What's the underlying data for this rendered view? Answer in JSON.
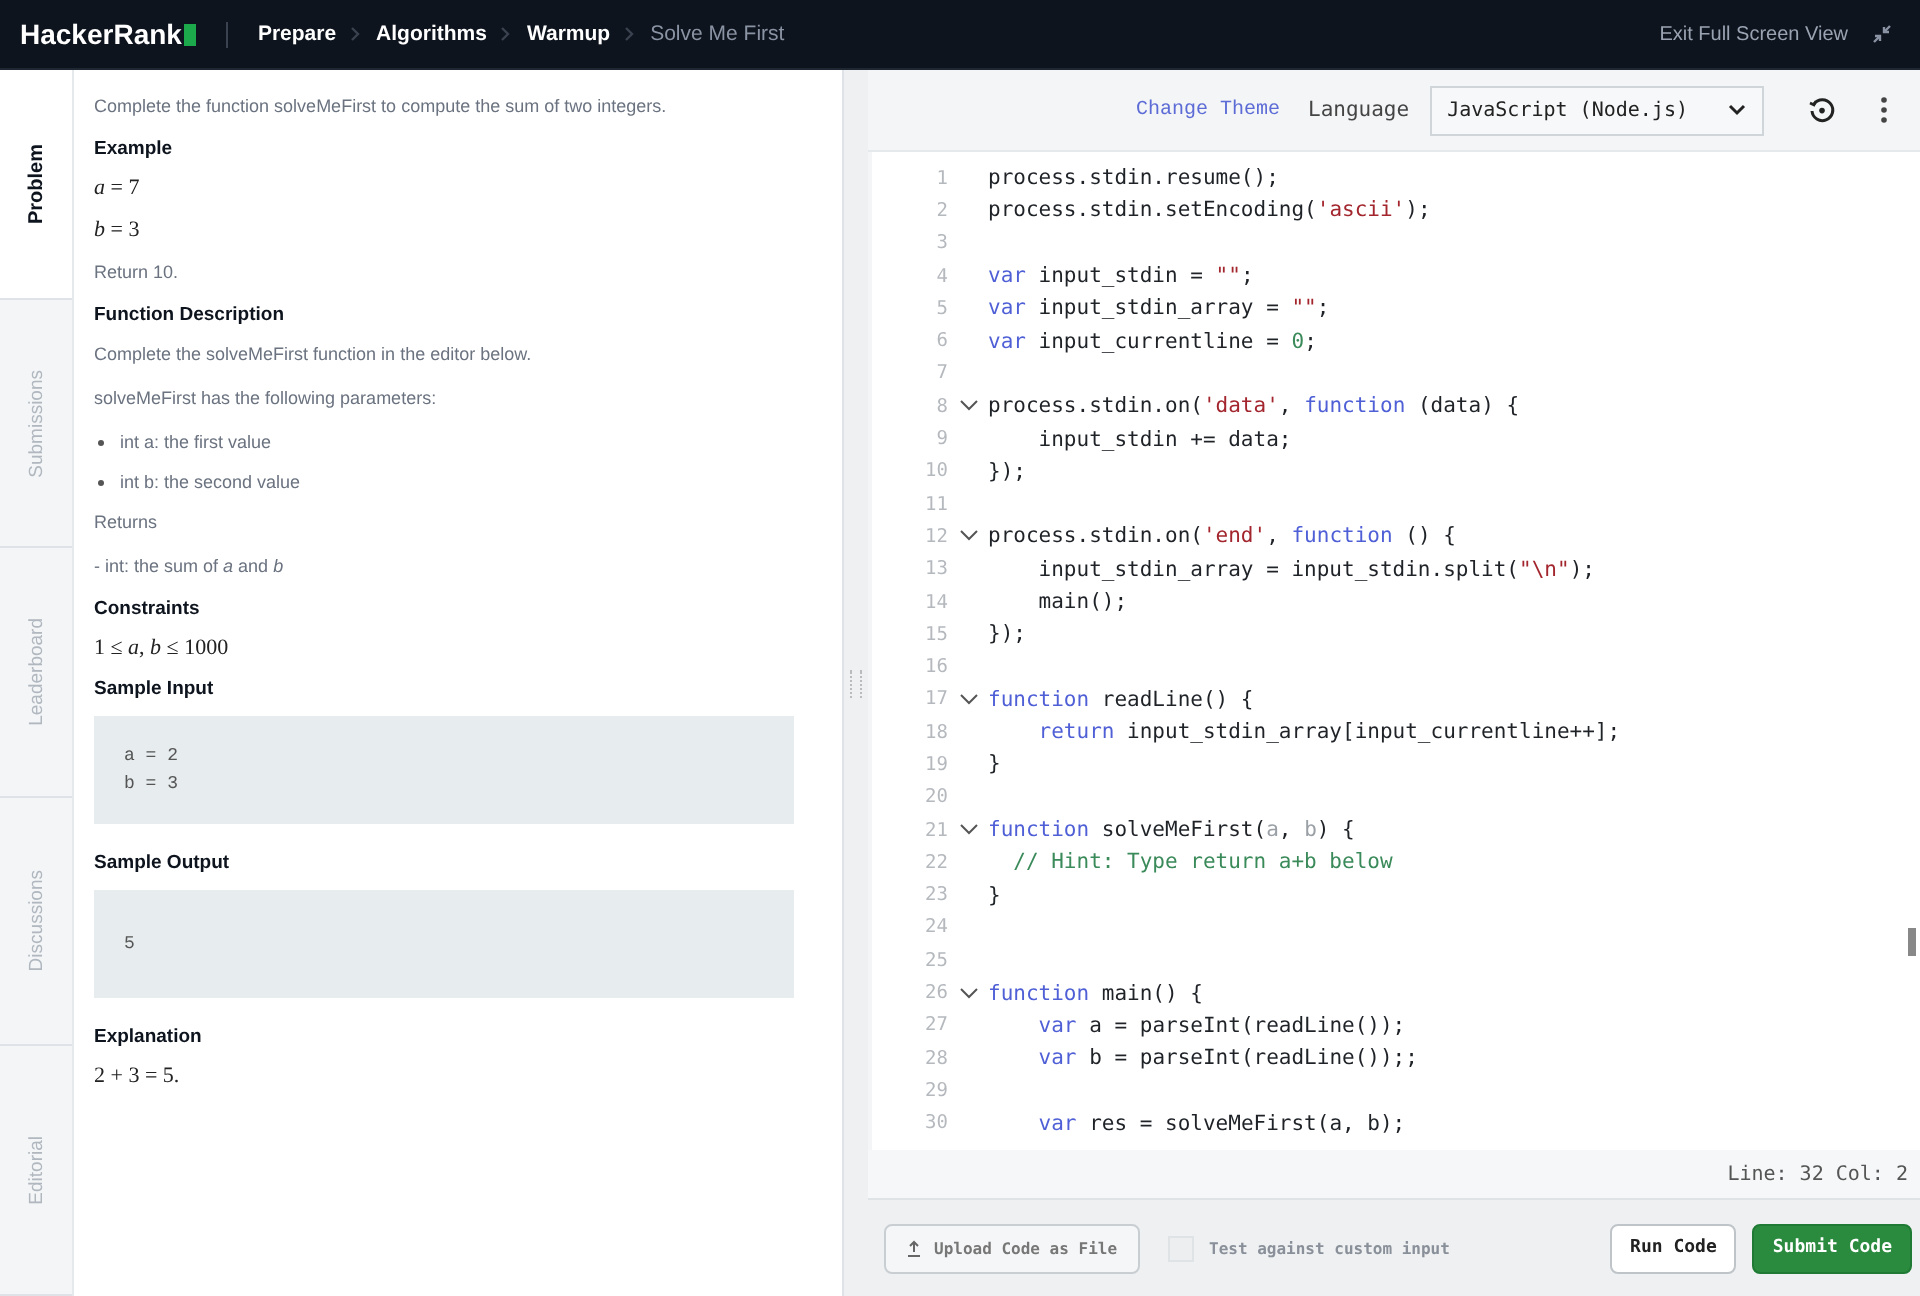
{
  "topbar": {
    "logo": "HackerRank",
    "breadcrumbs": [
      {
        "label": "Prepare",
        "current": false
      },
      {
        "label": "Algorithms",
        "current": false
      },
      {
        "label": "Warmup",
        "current": false
      },
      {
        "label": "Solve Me First",
        "current": true
      }
    ],
    "exit_link": "Exit Full Screen View"
  },
  "side_tabs": [
    {
      "label": "Problem",
      "selected": true
    },
    {
      "label": "Submissions",
      "selected": false
    },
    {
      "label": "Leaderboard",
      "selected": false
    },
    {
      "label": "Discussions",
      "selected": false
    },
    {
      "label": "Editorial",
      "selected": false
    }
  ],
  "problem": [
    {
      "kind": "text",
      "text": "Complete the function solveMeFirst to compute the sum of two integers."
    },
    {
      "kind": "heading",
      "text": "Example"
    },
    {
      "kind": "math",
      "text": "*a* = 7"
    },
    {
      "kind": "math",
      "text": "*b* = 3"
    },
    {
      "kind": "text",
      "text": "Return 10."
    },
    {
      "kind": "heading",
      "text": "Function Description"
    },
    {
      "kind": "text",
      "text": "Complete the solveMeFirst function in the editor below."
    },
    {
      "kind": "text",
      "text": "solveMeFirst has the following parameters:"
    },
    {
      "kind": "bullet",
      "text": "int a: the first value"
    },
    {
      "kind": "bullet",
      "text": "int b: the second value"
    },
    {
      "kind": "text",
      "text": "Returns"
    },
    {
      "kind": "text",
      "text": "- int: the sum of *a* and *b*"
    },
    {
      "kind": "heading",
      "text": "Constraints"
    },
    {
      "kind": "math",
      "text": "1 ≤ *a*, *b* ≤ 1000"
    },
    {
      "kind": "heading",
      "text": "Sample Input"
    },
    {
      "kind": "code",
      "lines": [
        "a = 2",
        "b = 3"
      ]
    },
    {
      "kind": "heading",
      "text": "Sample Output"
    },
    {
      "kind": "code",
      "lines": [
        "5"
      ]
    },
    {
      "kind": "heading",
      "text": "Explanation"
    },
    {
      "kind": "math",
      "text": "2 + 3 = 5."
    }
  ],
  "editor": {
    "change_theme": "Change Theme",
    "language_label": "Language",
    "language": "JavaScript (Node.js)",
    "lines": [
      {
        "number": "1",
        "fold": false,
        "tokens": [
          {
            "kind": "plain",
            "text": "process.stdin.resume();"
          }
        ]
      },
      {
        "number": "2",
        "fold": false,
        "tokens": [
          {
            "kind": "plain",
            "text": "process.stdin.setEncoding("
          },
          {
            "kind": "string",
            "text": "'ascii'"
          },
          {
            "kind": "plain",
            "text": ");"
          }
        ]
      },
      {
        "number": "3",
        "fold": false
      },
      {
        "number": "4",
        "fold": false,
        "tokens": [
          {
            "kind": "keyword",
            "text": "var"
          },
          {
            "kind": "plain",
            "text": " input_stdin = "
          },
          {
            "kind": "string",
            "text": "\"\""
          },
          {
            "kind": "plain",
            "text": ";"
          }
        ]
      },
      {
        "number": "5",
        "fold": false,
        "tokens": [
          {
            "kind": "keyword",
            "text": "var"
          },
          {
            "kind": "plain",
            "text": " input_stdin_array = "
          },
          {
            "kind": "string",
            "text": "\"\""
          },
          {
            "kind": "plain",
            "text": ";"
          }
        ]
      },
      {
        "number": "6",
        "fold": false,
        "tokens": [
          {
            "kind": "keyword",
            "text": "var"
          },
          {
            "kind": "plain",
            "text": " input_currentline = "
          },
          {
            "kind": "number",
            "text": "0"
          },
          {
            "kind": "plain",
            "text": ";"
          }
        ]
      },
      {
        "number": "7",
        "fold": false
      },
      {
        "number": "8",
        "fold": true,
        "tokens": [
          {
            "kind": "plain",
            "text": "process.stdin.on("
          },
          {
            "kind": "string",
            "text": "'data'"
          },
          {
            "kind": "plain",
            "text": ", "
          },
          {
            "kind": "keyword",
            "text": "function"
          },
          {
            "kind": "plain",
            "text": " (data) {"
          }
        ]
      },
      {
        "number": "9",
        "fold": false,
        "tokens": [
          {
            "kind": "plain",
            "text": "    input_stdin += data;"
          }
        ]
      },
      {
        "number": "10",
        "fold": false,
        "tokens": [
          {
            "kind": "plain",
            "text": "});"
          }
        ]
      },
      {
        "number": "11",
        "fold": false
      },
      {
        "number": "12",
        "fold": true,
        "tokens": [
          {
            "kind": "plain",
            "text": "process.stdin.on("
          },
          {
            "kind": "string",
            "text": "'end'"
          },
          {
            "kind": "plain",
            "text": ", "
          },
          {
            "kind": "keyword",
            "text": "function"
          },
          {
            "kind": "plain",
            "text": " () {"
          }
        ]
      },
      {
        "number": "13",
        "fold": false,
        "tokens": [
          {
            "kind": "plain",
            "text": "    input_stdin_array = input_stdin.split("
          },
          {
            "kind": "string",
            "text": "\"\\n\""
          },
          {
            "kind": "plain",
            "text": ");"
          }
        ]
      },
      {
        "number": "14",
        "fold": false,
        "tokens": [
          {
            "kind": "plain",
            "text": "    main();"
          }
        ]
      },
      {
        "number": "15",
        "fold": false,
        "tokens": [
          {
            "kind": "plain",
            "text": "});"
          }
        ]
      },
      {
        "number": "16",
        "fold": false
      },
      {
        "number": "17",
        "fold": true,
        "tokens": [
          {
            "kind": "keyword",
            "text": "function"
          },
          {
            "kind": "plain",
            "text": " readLine() {"
          }
        ]
      },
      {
        "number": "18",
        "fold": false,
        "tokens": [
          {
            "kind": "keyword",
            "text": "    return"
          },
          {
            "kind": "plain",
            "text": " input_stdin_array[input_currentline++];"
          }
        ]
      },
      {
        "number": "19",
        "fold": false,
        "tokens": [
          {
            "kind": "plain",
            "text": "}"
          }
        ]
      },
      {
        "number": "20",
        "fold": false
      },
      {
        "number": "21",
        "fold": true,
        "tokens": [
          {
            "kind": "keyword",
            "text": "function"
          },
          {
            "kind": "plain",
            "text": " solveMeFirst("
          },
          {
            "kind": "unused",
            "text": "a"
          },
          {
            "kind": "plain",
            "text": ", "
          },
          {
            "kind": "unused",
            "text": "b"
          },
          {
            "kind": "plain",
            "text": ") {"
          }
        ]
      },
      {
        "number": "22",
        "fold": false,
        "tokens": [
          {
            "kind": "comment",
            "text": "  // Hint: Type return a+b below"
          }
        ]
      },
      {
        "number": "23",
        "fold": false,
        "tokens": [
          {
            "kind": "plain",
            "text": "}"
          }
        ]
      },
      {
        "number": "24",
        "fold": false
      },
      {
        "number": "25",
        "fold": false
      },
      {
        "number": "26",
        "fold": true,
        "tokens": [
          {
            "kind": "keyword",
            "text": "function"
          },
          {
            "kind": "plain",
            "text": " main() {"
          }
        ]
      },
      {
        "number": "27",
        "fold": false,
        "tokens": [
          {
            "kind": "keyword",
            "text": "    var"
          },
          {
            "kind": "plain",
            "text": " a = parseInt(readLine());"
          }
        ]
      },
      {
        "number": "28",
        "fold": false,
        "tokens": [
          {
            "kind": "keyword",
            "text": "    var"
          },
          {
            "kind": "plain",
            "text": " b = parseInt(readLine());;"
          }
        ]
      },
      {
        "number": "29",
        "fold": false
      },
      {
        "number": "30",
        "fold": false,
        "tokens": [
          {
            "kind": "keyword",
            "text": "    var"
          },
          {
            "kind": "plain",
            "text": " res = solveMeFirst(a, b);"
          }
        ]
      }
    ],
    "cursor_status": "Line: 32 Col: 2"
  },
  "footer": {
    "upload": "Upload Code as File",
    "custom_input": {
      "label": "Test against custom input",
      "checked": false
    },
    "run": "Run Code",
    "submit": "Submit Code"
  }
}
